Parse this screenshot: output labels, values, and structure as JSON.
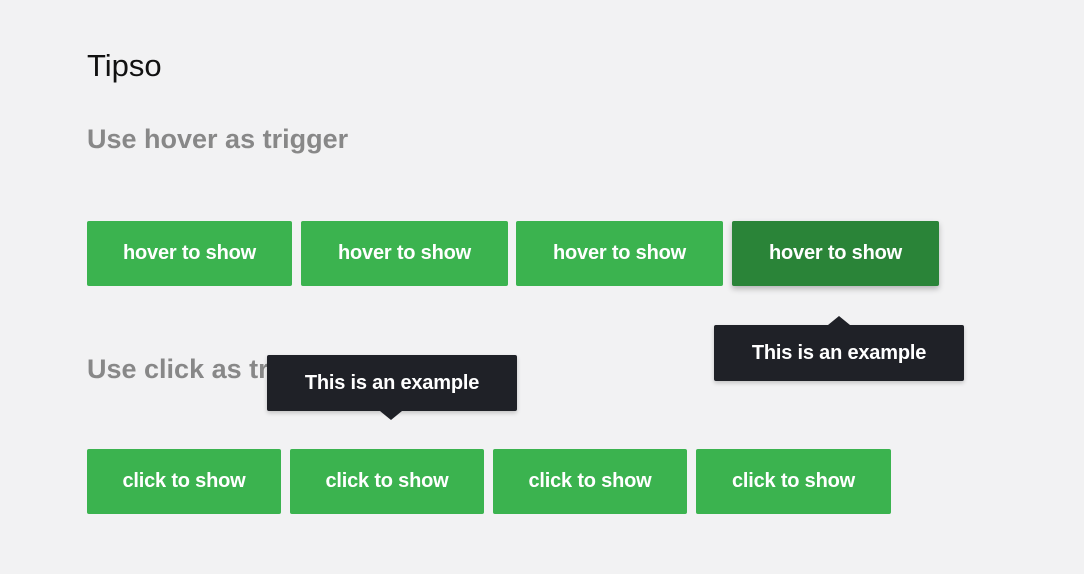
{
  "page": {
    "title": "Tipso",
    "hover_heading": "Use hover as trigger",
    "click_heading": "Use click as trigger"
  },
  "hover_buttons": [
    {
      "label": "hover to show"
    },
    {
      "label": "hover to show"
    },
    {
      "label": "hover to show"
    },
    {
      "label": "hover to show"
    }
  ],
  "click_buttons": [
    {
      "label": "click to show"
    },
    {
      "label": "click to show"
    },
    {
      "label": "click to show"
    },
    {
      "label": "click to show"
    }
  ],
  "tooltips": {
    "hover_tooltip": "This is an example",
    "click_tooltip": "This is an example"
  },
  "colors": {
    "button": "#3bb34f",
    "button_active": "#2a8438",
    "tooltip_bg": "#1f2127",
    "heading": "#888888",
    "background": "#f2f2f3"
  }
}
